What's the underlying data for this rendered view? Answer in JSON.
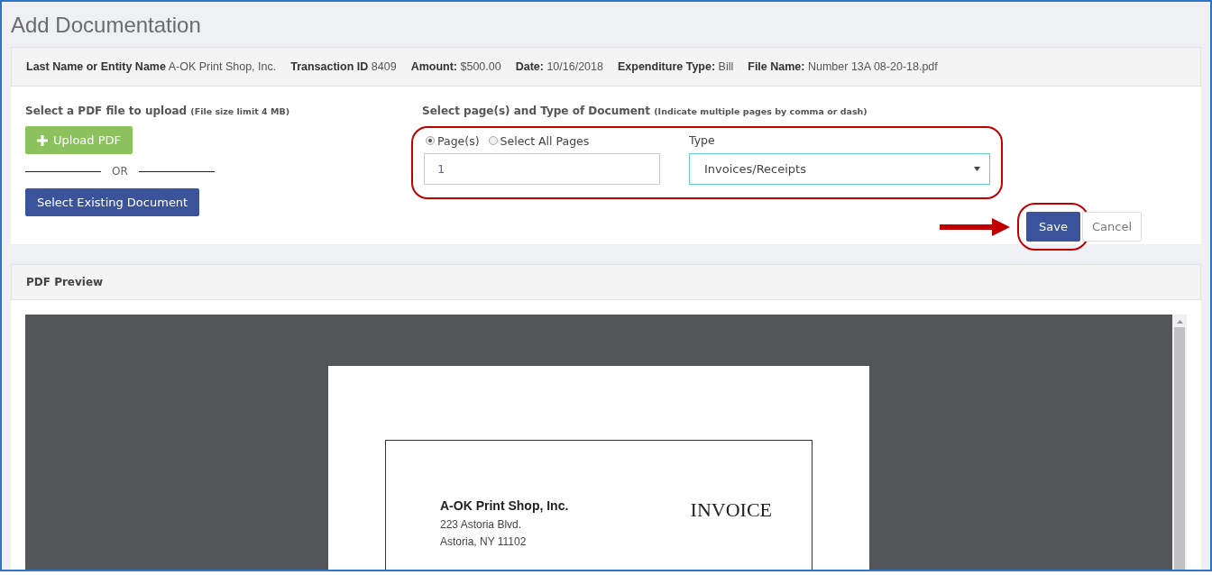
{
  "page_title": "Add Documentation",
  "info_bar": [
    {
      "label": "Last Name or Entity Name",
      "value": "A-OK Print Shop, Inc."
    },
    {
      "label": "Transaction ID",
      "value": "8409"
    },
    {
      "label": "Amount:",
      "value": "$500.00"
    },
    {
      "label": "Date:",
      "value": "10/16/2018"
    },
    {
      "label": "Expenditure Type:",
      "value": "Bill"
    },
    {
      "label": "File Name:",
      "value": "Number 13A 08-20-18.pdf"
    }
  ],
  "upload": {
    "heading": "Select a PDF file to upload",
    "note": "(File size limit 4 MB)",
    "upload_button": "Upload PDF",
    "divider": "OR",
    "existing_button": "Select Existing Document"
  },
  "pages": {
    "heading": "Select page(s) and Type of Document",
    "note": "(Indicate multiple pages by comma or dash)",
    "options": [
      {
        "label": "Page(s)",
        "selected": true
      },
      {
        "label": "Select All Pages",
        "selected": false
      }
    ],
    "pages_value": "1",
    "type_label": "Type",
    "type_value": "Invoices/Receipts",
    "highlighted": true
  },
  "actions": {
    "save": "Save",
    "cancel": "Cancel",
    "save_highlighted": true
  },
  "preview": {
    "heading": "PDF Preview",
    "company": "A-OK Print Shop, Inc.",
    "address_lines": [
      "223 Astoria Blvd.",
      "Astoria, NY 11102"
    ],
    "doc_title": "INVOICE"
  }
}
